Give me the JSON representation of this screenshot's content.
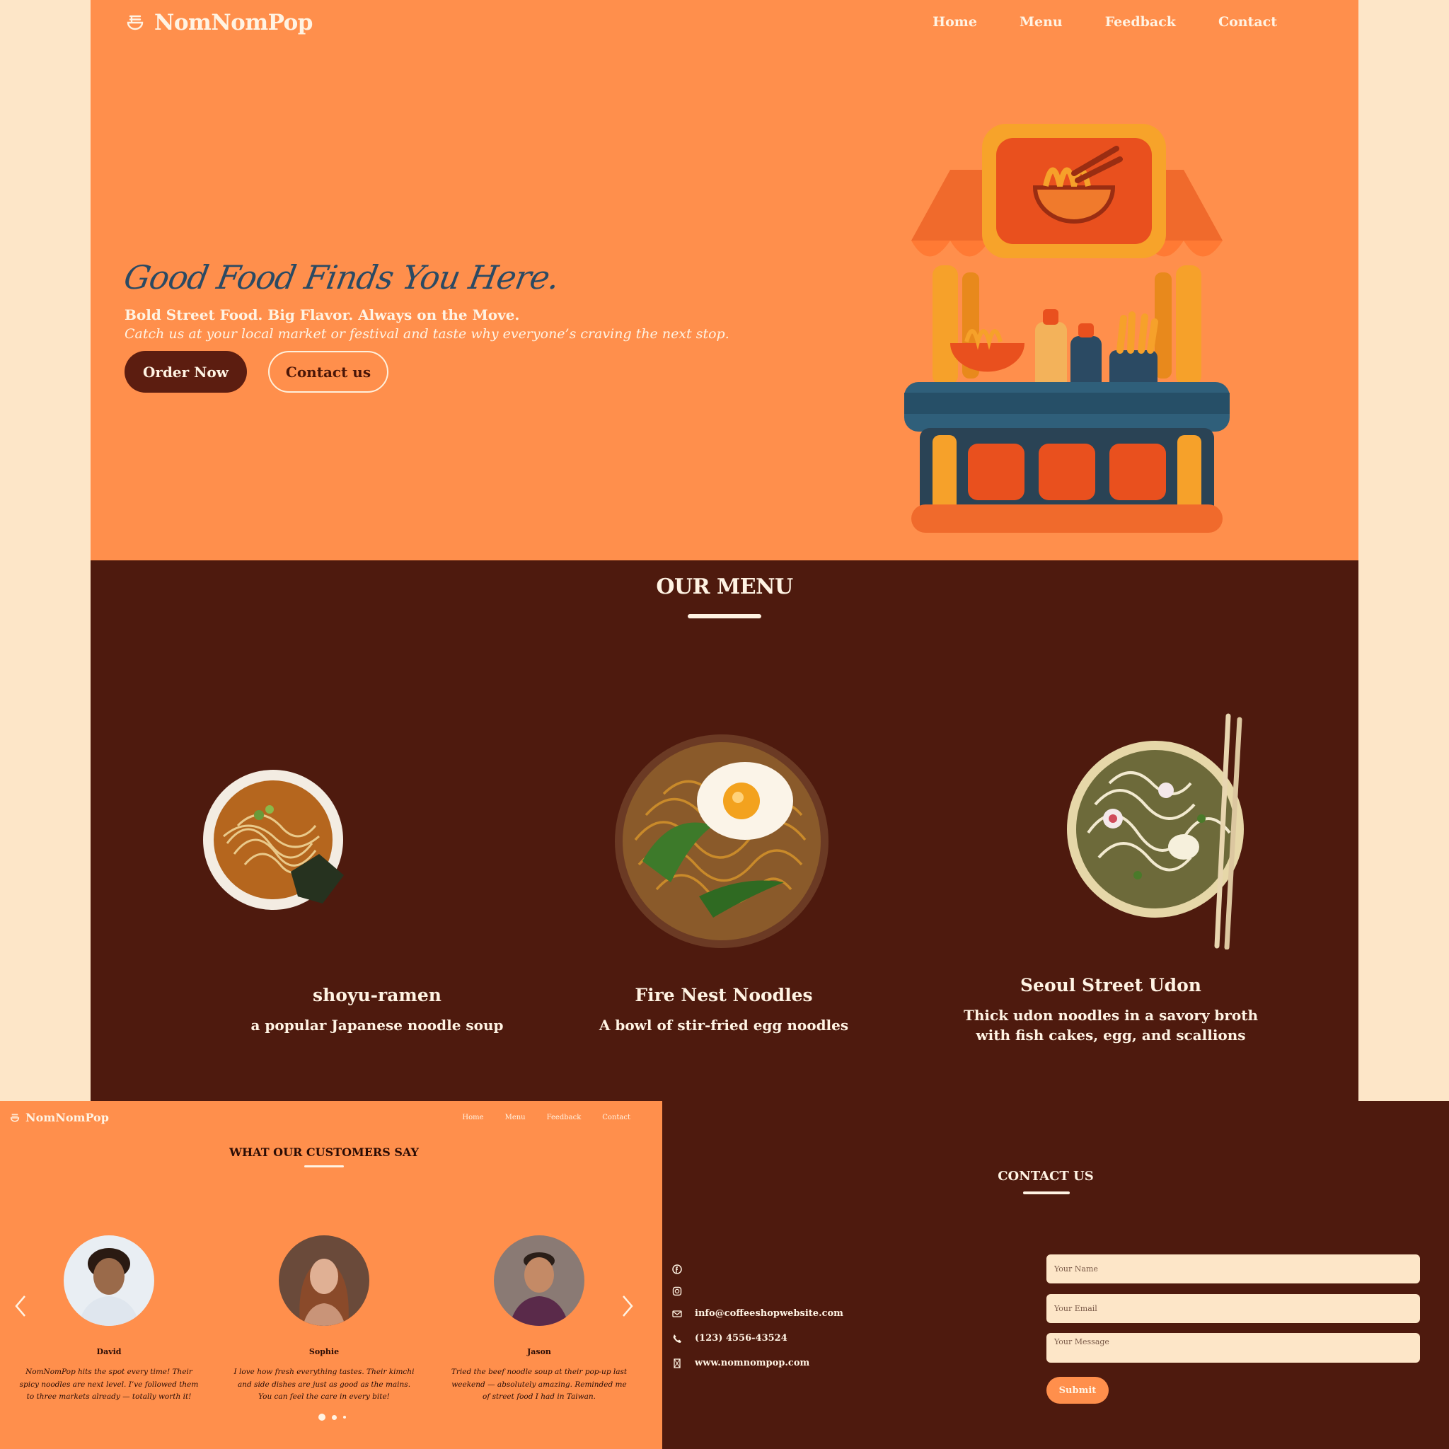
{
  "brand": {
    "name": "NomNomPop",
    "logo_icon": "noodle-bowl-icon"
  },
  "nav": {
    "items": [
      "Home",
      "Menu",
      "Feedback",
      "Contact"
    ]
  },
  "hero": {
    "tagline": "Good Food Finds You Here.",
    "subtitle": "Bold Street Food. Big Flavor. Always on the Move.",
    "description": "Catch us at your local market or festival and taste why everyone’s craving the next stop.",
    "order_label": "Order Now",
    "contact_label": "Contact us"
  },
  "menu": {
    "title": "OUR MENU",
    "items": [
      {
        "name": "shoyu-ramen",
        "description": "a popular Japanese noodle soup"
      },
      {
        "name": "Fire Nest Noodles",
        "description": "A bowl of stir-fried egg noodles"
      },
      {
        "name": "Seoul Street Udon",
        "description": "Thick udon noodles in a savory broth with fish cakes, egg, and scallions"
      }
    ]
  },
  "testimonials": {
    "title": "WHAT OUR CUSTOMERS SAY",
    "items": [
      {
        "name": "David",
        "quote": "NomNomPop hits the spot every time! Their spicy noodles are next level. I’ve followed them to three markets already — totally worth it!"
      },
      {
        "name": "Sophie",
        "quote": "I love how fresh everything tastes. Their kimchi and side dishes are just as good as the mains. You can feel the care in every bite!"
      },
      {
        "name": "Jason",
        "quote": "Tried the beef noodle soup at their pop-up last weekend — absolutely amazing. Reminded me of street food I had in Taiwan."
      }
    ]
  },
  "contact": {
    "title": "CONTACT US",
    "email": "info@coffeeshopwebsite.com",
    "phone": "(123) 4556-43524",
    "website": "www.nomnompop.com",
    "form": {
      "name_placeholder": "Your Name",
      "email_placeholder": "Your Email",
      "message_placeholder": "Your Message",
      "submit_label": "Submit"
    }
  },
  "colors": {
    "orange": "#ff8f4c",
    "brown": "#4e1a0e",
    "cream": "#fde6c8",
    "dark_button": "#5c1d10",
    "tagline_blue": "#2b4a63"
  }
}
